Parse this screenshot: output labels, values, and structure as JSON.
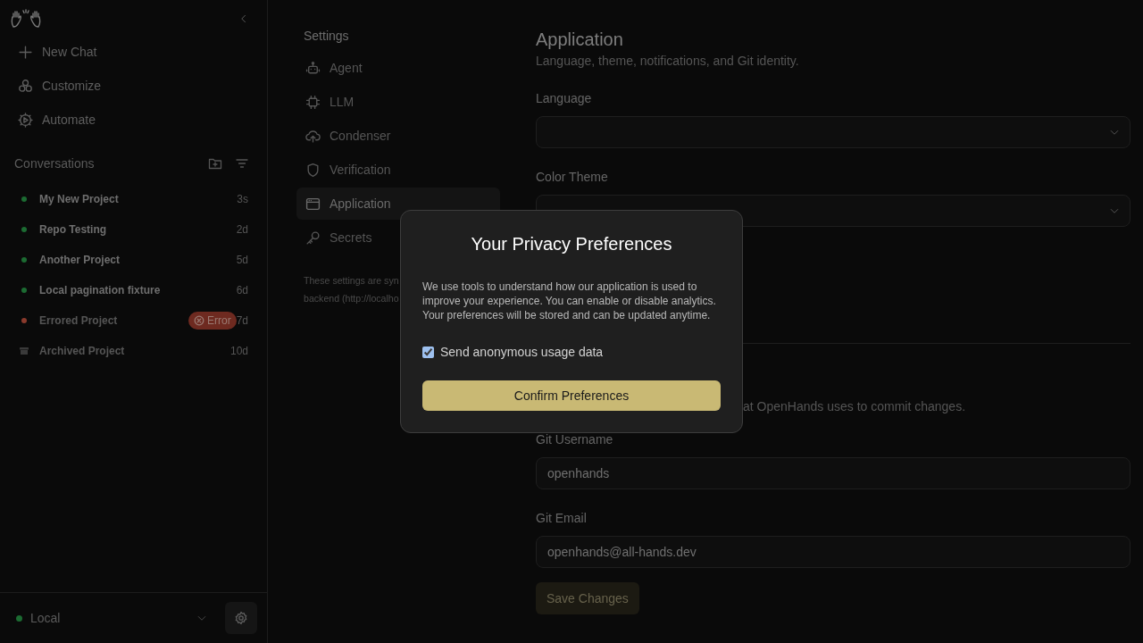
{
  "sidebar": {
    "nav": [
      {
        "label": "New Chat"
      },
      {
        "label": "Customize"
      },
      {
        "label": "Automate"
      }
    ],
    "conversations_title": "Conversations",
    "conversations": [
      {
        "title": "My New Project",
        "time": "3s",
        "kind": "dot",
        "color": "#1c6b32"
      },
      {
        "title": "Repo Testing",
        "time": "2d",
        "kind": "dot",
        "color": "#1c6b32"
      },
      {
        "title": "Another Project",
        "time": "5d",
        "kind": "dot",
        "color": "#1c6b32"
      },
      {
        "title": "Local pagination fixture",
        "time": "6d",
        "kind": "dot",
        "color": "#1c6b32"
      },
      {
        "title": "Errored Project",
        "time": "7d",
        "kind": "dot",
        "color": "#8a3a2c",
        "badge": "Error"
      },
      {
        "title": "Archived Project",
        "time": "10d",
        "kind": "archive"
      }
    ],
    "runtime": {
      "label": "Local",
      "color": "#1c6b32"
    }
  },
  "settings_nav": {
    "title": "Settings",
    "items": [
      {
        "label": "Agent",
        "selected": false
      },
      {
        "label": "LLM",
        "selected": false
      },
      {
        "label": "Condenser",
        "selected": false
      },
      {
        "label": "Verification",
        "selected": false
      },
      {
        "label": "Application",
        "selected": true
      },
      {
        "label": "Secrets",
        "selected": false
      }
    ],
    "note_lines": [
      "These settings are syn",
      "backend (http://localho"
    ]
  },
  "content": {
    "title": "Application",
    "subtitle": "Language, theme, notifications, and Git identity.",
    "language": {
      "label": "Language"
    },
    "color_theme": {
      "label": "Color Theme"
    },
    "git_note": "at OpenHands uses to commit changes.",
    "git_username": {
      "label": "Git Username",
      "value": "openhands"
    },
    "git_email": {
      "label": "Git Email",
      "value": "openhands@all-hands.dev"
    },
    "save_button": {
      "label": "Save Changes",
      "disabled": true
    }
  },
  "modal": {
    "title": "Your Privacy Preferences",
    "body": "We use tools to understand how our application is used to improve your experience. You can enable or disable analytics. Your preferences will be stored and can be updated anytime.",
    "checkbox": {
      "label": "Send anonymous usage data",
      "checked": true
    },
    "button": "Confirm Preferences"
  }
}
